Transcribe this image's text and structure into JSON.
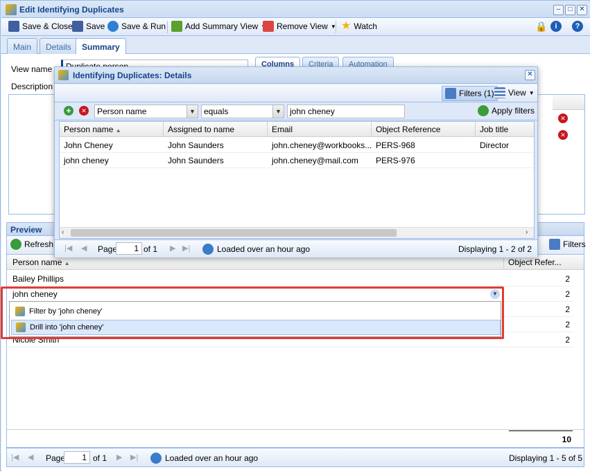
{
  "window": {
    "title": "Edit Identifying Duplicates"
  },
  "toolbar": {
    "save_close": "Save & Close",
    "save": "Save",
    "save_run": "Save & Run",
    "add_summary_view": "Add Summary View",
    "remove_view": "Remove View",
    "watch": "Watch"
  },
  "tabs": [
    {
      "label": "Main"
    },
    {
      "label": "Details"
    },
    {
      "label": "Summary"
    }
  ],
  "form": {
    "view_name_label": "View name",
    "view_name_value": "Duplicate person",
    "description_label": "Description",
    "inner_tabs": [
      {
        "label": "Columns"
      },
      {
        "label": "Criteria"
      },
      {
        "label": "Automation"
      }
    ]
  },
  "preview": {
    "title": "Preview",
    "refresh_label": "Refresh p",
    "filters_label": "Filters",
    "columns": [
      "Person name",
      "Object Refer..."
    ],
    "rows": [
      {
        "name": "Bailey Phillips",
        "count": "2"
      },
      {
        "name": "john cheney",
        "count": "2"
      },
      {
        "name": "",
        "count": "2"
      },
      {
        "name": "",
        "count": "2"
      },
      {
        "name": "Nicole Smith",
        "count": "2"
      }
    ],
    "total": "10",
    "pager": {
      "page_label": "Page",
      "page_value": "1",
      "of_label": "of 1",
      "loaded": "Loaded over an hour ago",
      "displaying": "Displaying 1 - 5 of 5"
    }
  },
  "dropdown": {
    "items": [
      {
        "label": "Filter by 'john cheney'"
      },
      {
        "label": "Drill into 'john cheney'"
      }
    ]
  },
  "modal": {
    "title": "Identifying Duplicates: Details",
    "filters_button": "Filters (1)",
    "view_button": "View",
    "filter": {
      "field": "Person name",
      "operator": "equals",
      "value": "john cheney",
      "apply": "Apply filters"
    },
    "columns": [
      "Person name",
      "Assigned to name",
      "Email",
      "Object Reference",
      "Job title"
    ],
    "rows": [
      {
        "name": "John Cheney",
        "assigned": "John Saunders",
        "email": "john.cheney@workbooks....",
        "ref": "PERS-968",
        "job": "Director"
      },
      {
        "name": "john cheney",
        "assigned": "John Saunders",
        "email": "john.cheney@mail.com",
        "ref": "PERS-976",
        "job": ""
      }
    ],
    "pager": {
      "page_label": "Page",
      "page_value": "1",
      "of_label": "of 1",
      "loaded": "Loaded over an hour ago",
      "displaying": "Displaying 1 - 2 of 2"
    }
  },
  "colors": {
    "accent": "#15428b",
    "highlight": "#e03c31",
    "panel": "#dfe8f6"
  }
}
